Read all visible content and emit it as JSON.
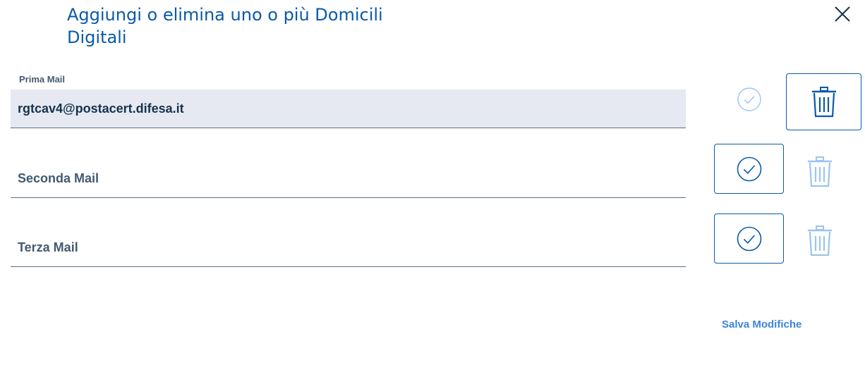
{
  "modal": {
    "title": "Aggiungi o elimina uno o più Domicili Digitali"
  },
  "fields": [
    {
      "label": "Prima Mail",
      "value": "rgtcav4@postacert.difesa.it",
      "placeholder": ""
    },
    {
      "label": "",
      "value": "",
      "placeholder": "Seconda Mail"
    },
    {
      "label": "",
      "value": "",
      "placeholder": "Terza Mail"
    }
  ],
  "icons": {
    "close": "close-icon",
    "confirm": "check-circle-icon",
    "delete": "trash-icon"
  },
  "colors": {
    "primary": "#0b5aa8",
    "primary_light": "#3b86d8",
    "disabled_icon": "#9cc4ef",
    "field_filled_bg": "#e6e9f2",
    "text": "#17324d"
  },
  "actions": {
    "save_label": "Salva Modifiche"
  }
}
